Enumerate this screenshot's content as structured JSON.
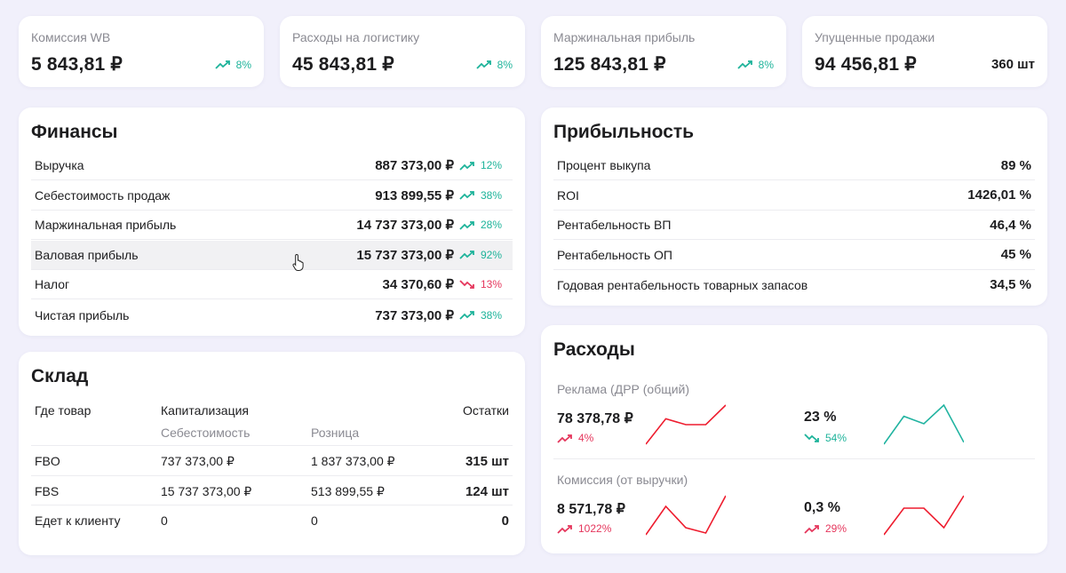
{
  "kpis": [
    {
      "label": "Комиссия WB",
      "value": "5 843,81 ₽",
      "trend": "8%",
      "dir": "up"
    },
    {
      "label": "Расходы на логистику",
      "value": "45 843,81 ₽",
      "trend": "8%",
      "dir": "up"
    },
    {
      "label": "Маржинальная прибыль",
      "value": "125 843,81 ₽",
      "trend": "8%",
      "dir": "up"
    },
    {
      "label": "Упущенные продажи",
      "value": "94 456,81 ₽",
      "count": "360 шт"
    }
  ],
  "finance": {
    "title": "Финансы",
    "rows": [
      {
        "label": "Выручка",
        "value": "887 373,00 ₽",
        "trend": "12%",
        "dir": "up"
      },
      {
        "label": "Себестоимость продаж",
        "value": "913 899,55 ₽",
        "trend": "38%",
        "dir": "up"
      },
      {
        "label": "Маржинальная прибыль",
        "value": "14 737 373,00 ₽",
        "trend": "28%",
        "dir": "up"
      },
      {
        "label": "Валовая прибыль",
        "value": "15 737 373,00 ₽",
        "trend": "92%",
        "dir": "up"
      },
      {
        "label": "Налог",
        "value": "34 370,60 ₽",
        "trend": "13%",
        "dir": "down"
      },
      {
        "label": "Чистая прибыль",
        "value": "737 373,00 ₽",
        "trend": "38%",
        "dir": "up"
      }
    ]
  },
  "profit": {
    "title": "Прибыльность",
    "rows": [
      {
        "label": "Процент выкупа",
        "value": "89 %"
      },
      {
        "label": "ROI",
        "value": "1426,01 %"
      },
      {
        "label": "Рентабельность ВП",
        "value": "46,4 %"
      },
      {
        "label": "Рентабельность ОП",
        "value": "45 %"
      },
      {
        "label": "Годовая рентабельность товарных запасов",
        "value": "34,5 %"
      }
    ]
  },
  "warehouse": {
    "title": "Склад",
    "col_where": "Где товар",
    "col_cap": "Капитализация",
    "col_remain": "Остатки",
    "sub_cost": "Себестоимость",
    "sub_retail": "Розница",
    "rows": [
      {
        "where": "FBO",
        "cost": "737 373,00 ₽",
        "retail": "1 837 373,00 ₽",
        "remain": "315 шт"
      },
      {
        "where": "FBS",
        "cost": "15 737 373,00 ₽",
        "retail": "513 899,55 ₽",
        "remain": "124 шт"
      },
      {
        "where": "Едет к клиенту",
        "cost": "0",
        "retail": "0",
        "remain": "0"
      }
    ]
  },
  "expenses": {
    "title": "Расходы",
    "sections": [
      {
        "label": "Реклама (ДРР (общий)",
        "left": {
          "value": "78 378,78 ₽",
          "trend": "4%",
          "dir": "up-red",
          "spark": [
            2,
            28,
            22,
            22,
            42
          ]
        },
        "right": {
          "value": "23 %",
          "trend": "54%",
          "dir": "down-teal",
          "spark": [
            0,
            30,
            22,
            42,
            2
          ]
        }
      },
      {
        "label": "Комиссия (от выручки)",
        "left": {
          "value": "8 571,78 ₽",
          "trend": "1022%",
          "dir": "up-red",
          "spark": [
            0,
            32,
            8,
            2,
            44
          ]
        },
        "right": {
          "value": "0,3 %",
          "trend": "29%",
          "dir": "up-red",
          "spark": [
            0,
            30,
            30,
            8,
            44
          ]
        }
      }
    ]
  },
  "colors": {
    "teal": "#1db39a",
    "red": "#e5365c",
    "spark_red": "#ee1c2e",
    "spark_teal": "#20b3a0"
  }
}
